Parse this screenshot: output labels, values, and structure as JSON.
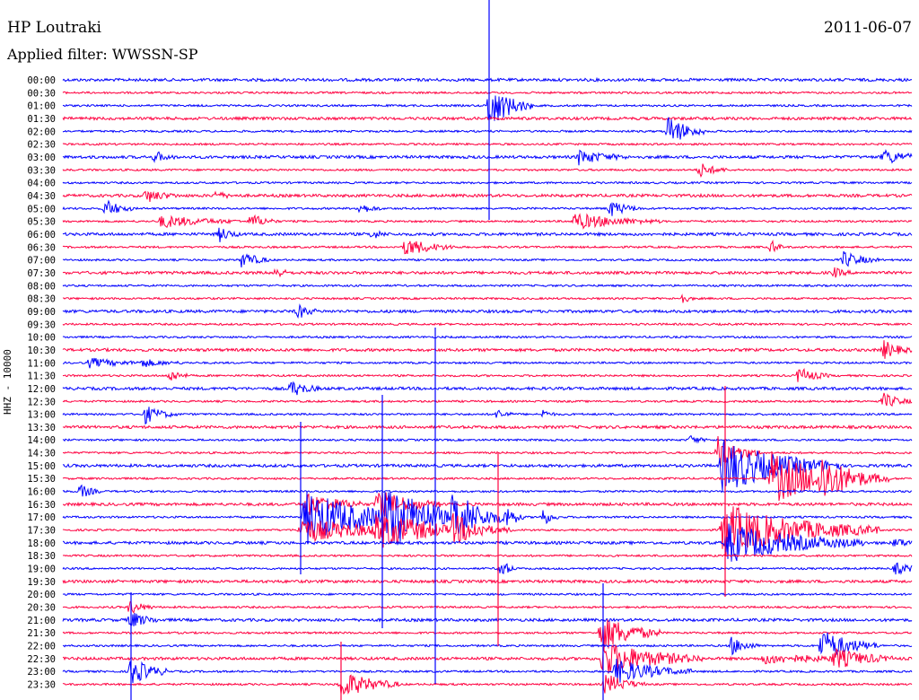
{
  "header": {
    "station": "HP Loutraki",
    "filter": "Applied filter: WWSSN-SP",
    "date": "2011-06-07"
  },
  "chart_data": {
    "type": "line",
    "ylabel": "HHZ - 10000",
    "y_ticks": [
      "00:00",
      "00:30",
      "01:00",
      "01:30",
      "02:00",
      "02:30",
      "03:00",
      "03:30",
      "04:00",
      "04:30",
      "05:00",
      "05:30",
      "06:00",
      "06:30",
      "07:00",
      "07:30",
      "08:00",
      "08:30",
      "09:00",
      "09:30",
      "10:00",
      "10:30",
      "11:00",
      "11:30",
      "12:00",
      "12:30",
      "13:00",
      "13:30",
      "14:00",
      "14:30",
      "15:00",
      "15:30",
      "16:00",
      "16:30",
      "17:00",
      "17:30",
      "18:00",
      "18:30",
      "19:00",
      "19:30",
      "20:00",
      "20:30",
      "21:00",
      "21:30",
      "22:00",
      "22:30",
      "23:00",
      "23:30"
    ],
    "series_colors": [
      "#0000ff",
      "#ff0040"
    ],
    "grid": false,
    "legend": "none"
  }
}
